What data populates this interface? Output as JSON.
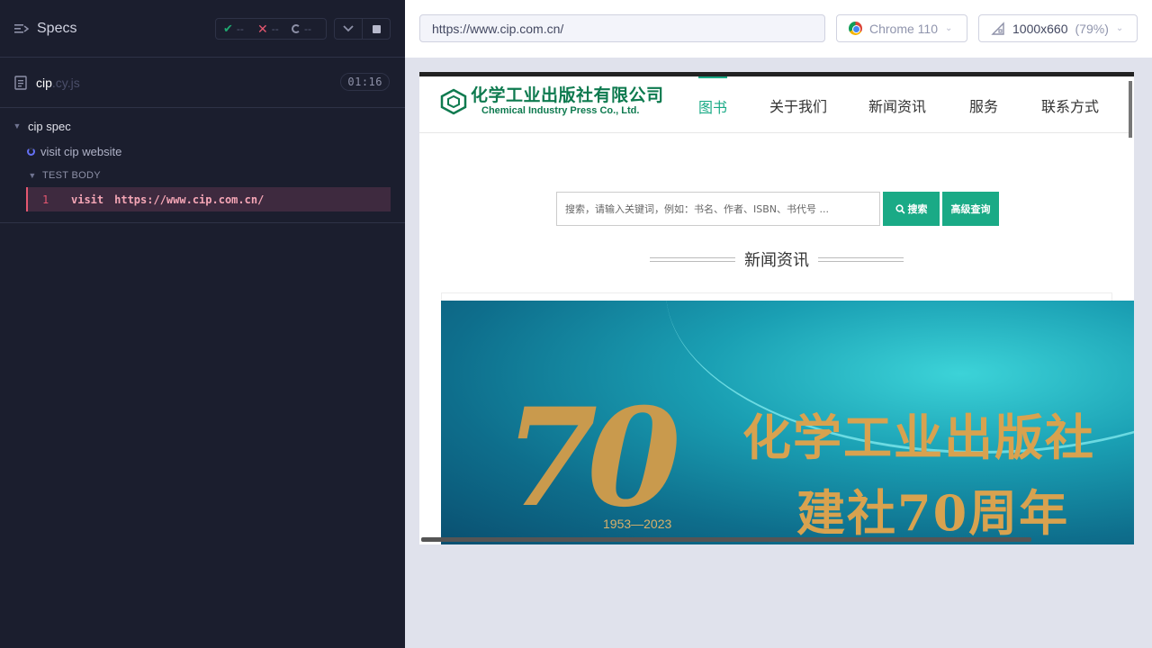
{
  "reporter": {
    "title": "Specs",
    "stats": {
      "passed": "--",
      "failed": "--",
      "pending": "--"
    },
    "file": {
      "name": "cip",
      "ext": ".cy.js",
      "duration": "01:16"
    },
    "suite": "cip spec",
    "test": "visit cip website",
    "body_label": "TEST BODY",
    "command": {
      "number": "1",
      "name": "visit",
      "message": "https://www.cip.com.cn/"
    }
  },
  "aut": {
    "url": "https://www.cip.com.cn/",
    "browser": "Chrome 110",
    "viewport": "1000x660",
    "zoom": "(79%)"
  },
  "site": {
    "logo_cn": "化学工业出版社有限公司",
    "logo_en": "Chemical Industry Press Co., Ltd.",
    "nav": [
      "图书",
      "关于我们",
      "新闻资讯",
      "服务",
      "联系方式"
    ],
    "search_placeholder": "搜索，请输入关键词，例如：书名、作者、ISBN、书代号 ...",
    "search_button": "搜索",
    "advanced_button": "高级查询",
    "section_title": "新闻资讯",
    "banner": {
      "number": "70",
      "years": "1953—2023",
      "line1": "化学工业出版社",
      "line2": "建社70周年"
    }
  },
  "colors": {
    "accent": "#1aaa86",
    "reporter_bg": "#1b1e2e",
    "fail": "#e45770",
    "pass": "#1fa971"
  }
}
